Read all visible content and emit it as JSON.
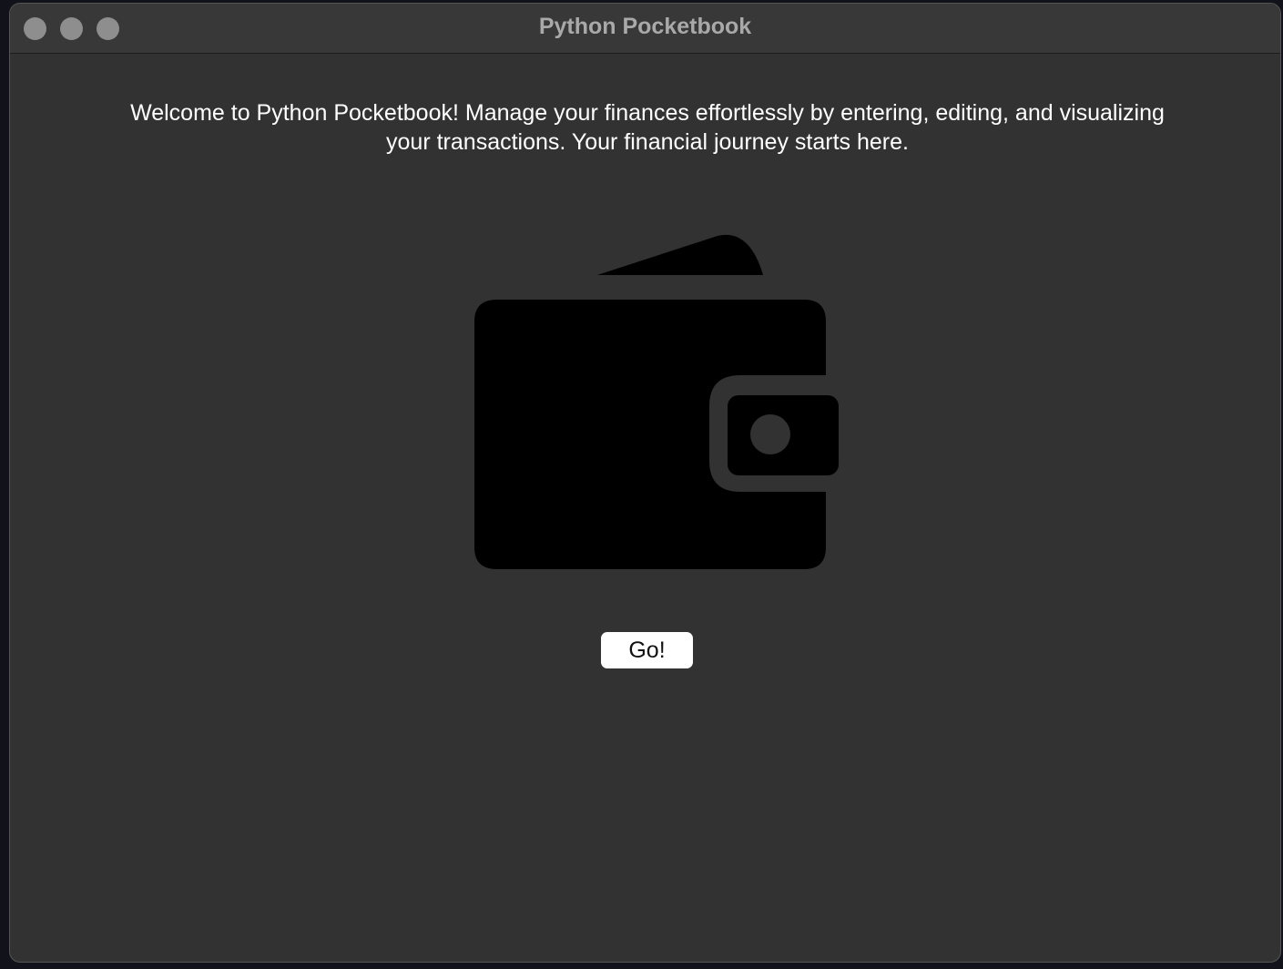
{
  "window": {
    "title": "Python Pocketbook"
  },
  "main": {
    "welcome_text": "Welcome to Python Pocketbook! Manage your finances effortlessly by entering, editing, and visualizing your transactions. Your financial journey starts here.",
    "go_button_label": "Go!"
  },
  "icons": {
    "hero": "wallet-icon"
  },
  "colors": {
    "window_bg": "#323232",
    "titlebar_bg": "#383838",
    "text": "#ffffff",
    "button_bg": "#ffffff",
    "icon": "#000000"
  }
}
